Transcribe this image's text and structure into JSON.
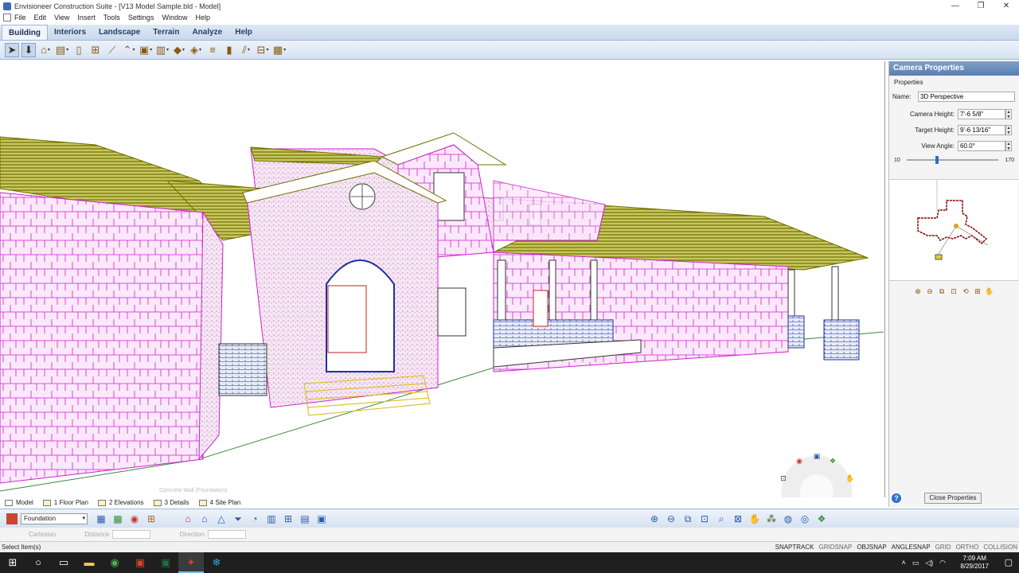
{
  "window": {
    "title": "Envisioneer Construction Suite - [V13 Model Sample.bld - Model]",
    "controls": [
      "—",
      "❐",
      "✕"
    ]
  },
  "menu": [
    "File",
    "Edit",
    "View",
    "Insert",
    "Tools",
    "Settings",
    "Window",
    "Help"
  ],
  "ribbon_tabs": [
    {
      "label": "Building",
      "active": true
    },
    {
      "label": "Interiors",
      "active": false
    },
    {
      "label": "Landscape",
      "active": false
    },
    {
      "label": "Terrain",
      "active": false
    },
    {
      "label": "Analyze",
      "active": false
    },
    {
      "label": "Help",
      "active": false
    }
  ],
  "toolbar_icons": [
    "pointer-icon",
    "stamp-icon",
    "house-icon",
    "wall-icon",
    "door-icon",
    "window-icon",
    "stair-icon",
    "roof-icon",
    "fill-icon",
    "floor-icon",
    "ramp-icon",
    "column-icon",
    "dimension-icon",
    "elevation-icon",
    "cabinet-icon"
  ],
  "properties_panel": {
    "title": "Camera Properties",
    "section": "Properties",
    "name_label": "Name:",
    "name_value": "3D Perspective",
    "camera_height_label": "Camera Height:",
    "camera_height_value": "7'-6 5/8\"",
    "target_height_label": "Target Height:",
    "target_height_value": "9'-6 13/16\"",
    "view_angle_label": "View Angle:",
    "view_angle_value": "60.0°",
    "slider_min": "10",
    "slider_max": "170",
    "slider_fraction": 0.31,
    "close_button": "Close Properties",
    "help_label": "?"
  },
  "sheet_tabs": [
    {
      "label": "Model",
      "active": true
    },
    {
      "label": "1 Floor Plan",
      "active": false
    },
    {
      "label": "2 Elevations",
      "active": false
    },
    {
      "label": "3 Details",
      "active": false
    },
    {
      "label": "4 Site Plan",
      "active": false
    }
  ],
  "hover_tooltip": "Concrete Wall  (Foundation)",
  "layer": {
    "selected": "Foundation"
  },
  "coordinate_bar": {
    "mode": "Cartesian",
    "distance_label": "Distance",
    "direction_label": "Direction"
  },
  "status": {
    "message": "Select Item(s)",
    "snaps": [
      {
        "label": "SNAPTRACK",
        "on": true
      },
      {
        "label": "GRIDSNAP",
        "on": false
      },
      {
        "label": "OBJSNAP",
        "on": true
      },
      {
        "label": "ANGLESNAP",
        "on": true
      },
      {
        "label": "GRID",
        "on": false
      },
      {
        "label": "ORTHO",
        "on": false
      },
      {
        "label": "COLLISION",
        "on": false
      }
    ]
  },
  "taskbar": {
    "time": "7:09 AM",
    "date": "8/29/2017"
  },
  "colors": {
    "roof": "#8a8a10",
    "wall_stone": "#d020d0",
    "accent": "#2a6fcf",
    "stair": "#e0c030"
  }
}
